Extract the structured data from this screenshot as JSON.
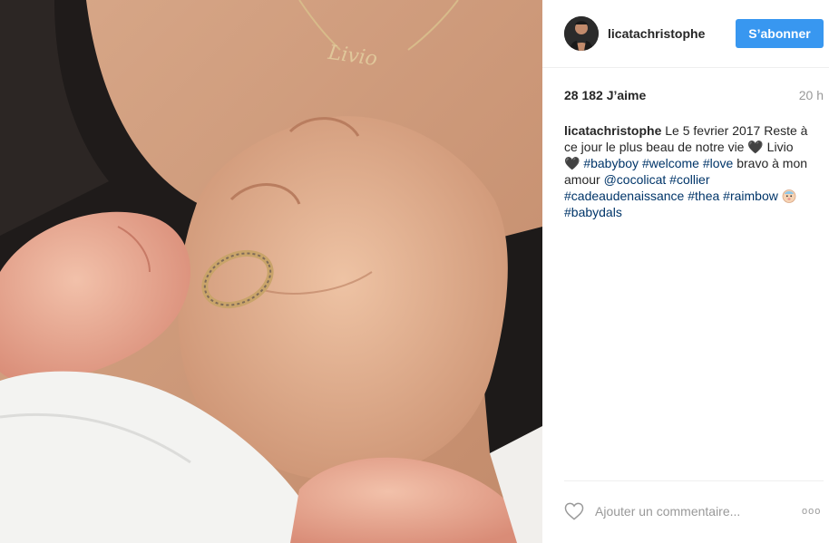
{
  "post": {
    "username": "licatachristophe",
    "follow_label": "S’abonner",
    "likes": "28 182 J’aime",
    "time": "20 h",
    "caption": {
      "author": "licatachristophe",
      "text_1": " Le 5 fevrier 2017 Reste à ce jour le plus beau de notre vie ",
      "heart_1": "🖤",
      "text_2": " Livio ",
      "heart_2": "🖤",
      "space_a": " ",
      "tag_babyboy": "#babyboy",
      "space_b": " ",
      "tag_welcome": "#welcome",
      "space_c": " ",
      "tag_love": "#love",
      "text_3": " bravo à mon amour ",
      "mention_cocolicat": "@cocolicat",
      "space_d": " ",
      "tag_collier": "#collier",
      "space_e": " ",
      "tag_cadeau": "#cadeaudenaissance",
      "space_f": " ",
      "tag_thea": "#thea",
      "space_g": " ",
      "tag_raimbow": "#raimbow",
      "space_h": " ",
      "baby_emoji": "baby-face-icon",
      "space_i": " ",
      "tag_babydals": "#babydals"
    },
    "comment_placeholder": "Ajouter un commentaire...",
    "more_label": "ooo",
    "necklace_text": "Livio"
  },
  "icons": {
    "heart": "heart-outline-icon",
    "more": "more-options-icon"
  },
  "colors": {
    "follow_button": "#3897f0",
    "hashtag": "#003569",
    "muted": "#999999"
  }
}
